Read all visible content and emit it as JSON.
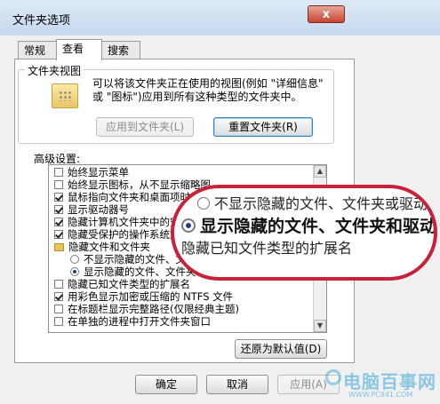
{
  "window": {
    "title": "文件夹选项",
    "close_label": "x"
  },
  "tabs": [
    {
      "label": "常规"
    },
    {
      "label": "查看"
    },
    {
      "label": "搜索"
    }
  ],
  "folder_view": {
    "title": "文件夹视图",
    "description": "可以将该文件夹正在使用的视图(例如 \"详细信息\" 或 \"图标\")应用到所有这种类型的文件夹中。",
    "apply_button": "应用到文件夹(L)",
    "reset_button": "重置文件夹(R)"
  },
  "advanced": {
    "label": "高级设置:",
    "items": [
      {
        "text": "始终显示菜单",
        "kind": "checkbox",
        "checked": false
      },
      {
        "text": "始终显示图标，从不显示缩略图",
        "kind": "checkbox",
        "checked": false
      },
      {
        "text": "鼠标指向文件夹和桌面项时显示提示信息",
        "kind": "checkbox",
        "checked": true
      },
      {
        "text": "显示驱动器号",
        "kind": "checkbox",
        "checked": true
      },
      {
        "text": "隐藏计算机文件夹中的空驱动器",
        "kind": "checkbox",
        "checked": true
      },
      {
        "text": "隐藏受保护的操作系统文件(推荐)",
        "kind": "checkbox",
        "checked": true
      },
      {
        "text": "隐藏文件和文件夹",
        "kind": "folder",
        "checked": false
      },
      {
        "text": "不显示隐藏的文件、文件夹或驱动器",
        "kind": "radio",
        "checked": false
      },
      {
        "text": "显示隐藏的文件、文件夹和驱动器",
        "kind": "radio",
        "checked": true
      },
      {
        "text": "隐藏已知文件类型的扩展名",
        "kind": "checkbox",
        "checked": false
      },
      {
        "text": "用彩色显示加密或压缩的 NTFS 文件",
        "kind": "checkbox",
        "checked": true
      },
      {
        "text": "在标题栏显示完整路径(仅限经典主题)",
        "kind": "checkbox",
        "checked": false
      },
      {
        "text": "在单独的进程中打开文件夹窗口",
        "kind": "checkbox",
        "checked": false
      }
    ],
    "restore_button": "还原为默认值(D)"
  },
  "magnifier": {
    "row1": "不显示隐藏的文件、文件夹或驱动",
    "row2": "显示隐藏的文件、文件夹和驱动器",
    "row3": "隐藏已知文件类型的扩展名"
  },
  "footer": {
    "ok_button": "确定",
    "cancel_button": "取消",
    "apply_button": "应用(A)"
  },
  "watermark": {
    "text": "电脑百事网",
    "url": "WWW.PC841.COM"
  }
}
